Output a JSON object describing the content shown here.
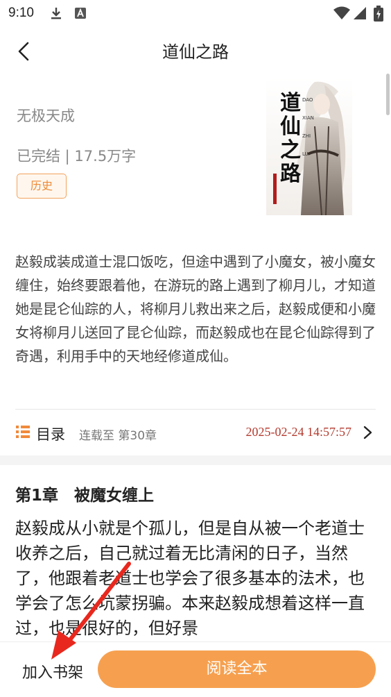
{
  "status_bar": {
    "time": "9:10"
  },
  "header": {
    "title": "道仙之路"
  },
  "book": {
    "author": "无极天成",
    "meta": "已完结 | 17.5万字",
    "tag": "历史",
    "cover": {
      "title_chars": [
        "道",
        "仙",
        "之",
        "路"
      ],
      "pinyin": [
        "DAO",
        "XIAN",
        "ZHI",
        "LU"
      ]
    }
  },
  "description": "赵毅成装成道士混口饭吃，但途中遇到了小魔女，被小魔女缠住，始终要跟着他，在游玩的路上遇到了柳月儿，才知道她是昆仑仙踪的人，将柳月儿救出来之后，赵毅成便和小魔女将柳月儿送回了昆仑仙踪，而赵毅成也在昆仑仙踪得到了奇遇，利用手中的天地经修道成仙。",
  "toc": {
    "label": "目录",
    "status": "连载至 第30章",
    "updated": "2025-02-24 14:57:57"
  },
  "chapter": {
    "title": "第1章　被魔女缠上",
    "text": "赵毅成从小就是个孤儿，但是自从被一个老道士收养之后，自己就过着无比清闲的日子，当然了，他跟着老道士也学会了很多基本的法术，也学会了怎么坑蒙拐骗。本来赵毅成想着这样一直过，也是很好的，但好景"
  },
  "bottom": {
    "add_shelf": "加入书架",
    "read_all": "阅读全本"
  },
  "colors": {
    "accent": "#f6a04f",
    "tag_text": "#ee8a36",
    "date": "#b33a2e",
    "annotation_arrow": "#e8281e"
  }
}
